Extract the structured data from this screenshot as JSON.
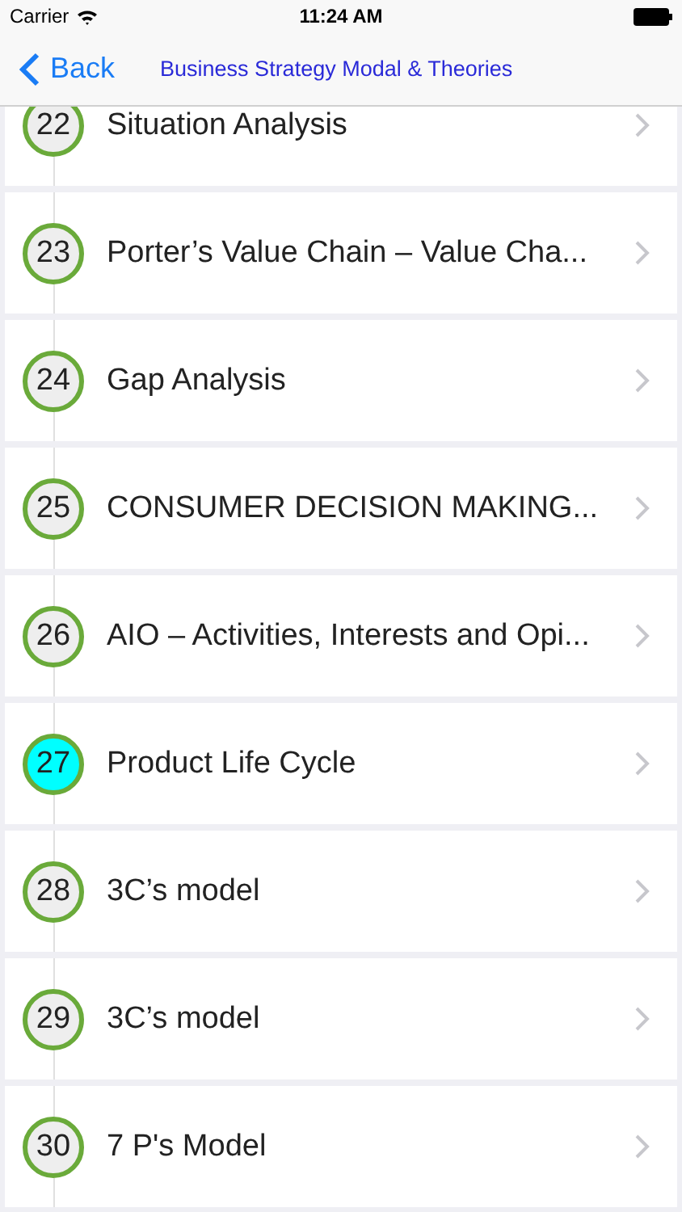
{
  "status_bar": {
    "carrier": "Carrier",
    "time": "11:24 AM"
  },
  "nav": {
    "back": "Back",
    "title": "Business Strategy Modal & Theories"
  },
  "items": [
    {
      "number": "22",
      "title": "Situation Analysis",
      "selected": false
    },
    {
      "number": "23",
      "title": "Porter’s Value Chain – Value Cha...",
      "selected": false
    },
    {
      "number": "24",
      "title": "Gap Analysis",
      "selected": false
    },
    {
      "number": "25",
      "title": "CONSUMER DECISION MAKING...",
      "selected": false
    },
    {
      "number": "26",
      "title": "AIO – Activities, Interests and Opi...",
      "selected": false
    },
    {
      "number": "27",
      "title": "Product Life Cycle",
      "selected": true
    },
    {
      "number": "28",
      "title": "3C’s model",
      "selected": false
    },
    {
      "number": "29",
      "title": "3C’s model",
      "selected": false
    },
    {
      "number": "30",
      "title": "7 P's Model",
      "selected": false
    }
  ]
}
